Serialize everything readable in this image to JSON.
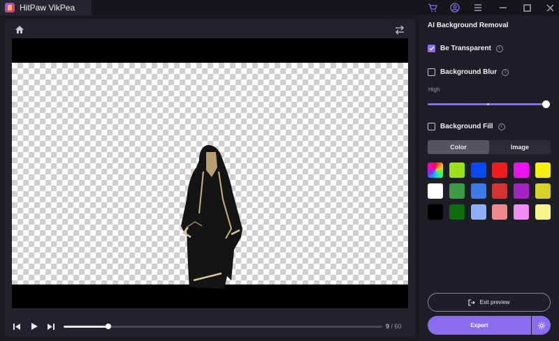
{
  "app": {
    "title": "HitPaw VikPea"
  },
  "titlebar": {
    "icons": [
      "cart-icon",
      "account-icon",
      "menu-icon",
      "minimize-icon",
      "maximize-icon",
      "close-icon"
    ]
  },
  "preview": {
    "icons": [
      "home-icon",
      "compare-swap-icon"
    ],
    "frame_current": "9",
    "frame_separator": " / ",
    "frame_total": "60",
    "progress": 0.14
  },
  "panel": {
    "title": "AI Background Removal",
    "be_transparent": {
      "label": "Be Transparent",
      "checked": true
    },
    "background_blur": {
      "label": "Background Blur",
      "checked": false
    },
    "blur_level_label": "High",
    "blur_level": 1.0,
    "background_fill": {
      "label": "Background Fill",
      "checked": false
    },
    "fill_tabs": [
      {
        "label": "Color",
        "active": true
      },
      {
        "label": "Image",
        "active": false
      }
    ],
    "swatches": [
      "conic",
      "#9be11a",
      "#0a48f5",
      "#f01e1e",
      "#ef10ef",
      "#f2f20a",
      "#ffffff",
      "#3e9a44",
      "#3f7be8",
      "#d53232",
      "#a523c2",
      "#d4d128",
      "#000000",
      "#0c6d0d",
      "#8fb0f8",
      "#f08a8a",
      "#f28cf2",
      "#f6f48a"
    ],
    "exit_preview_label": "Exit preview",
    "export_label": "Export"
  },
  "colors": {
    "accent": "#8a6cf0",
    "background": "#1a1a20"
  }
}
